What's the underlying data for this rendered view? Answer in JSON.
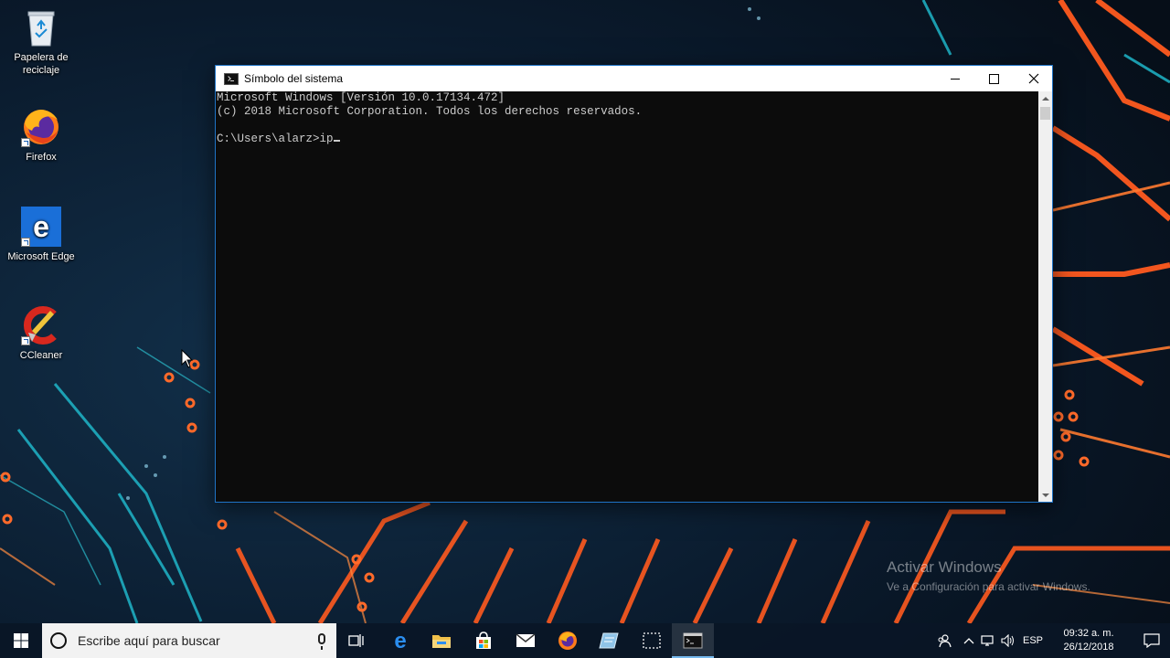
{
  "desktop": {
    "icons": [
      {
        "label": "Papelera de\nreciclaje",
        "icon": "recycle-bin-icon"
      },
      {
        "label": "Firefox",
        "icon": "firefox-icon"
      },
      {
        "label": "Microsoft Edge",
        "icon": "edge-icon"
      },
      {
        "label": "CCleaner",
        "icon": "ccleaner-icon"
      }
    ]
  },
  "window": {
    "title": "Símbolo del sistema",
    "console_lines": [
      "Microsoft Windows [Versión 10.0.17134.472]",
      "(c) 2018 Microsoft Corporation. Todos los derechos reservados.",
      "",
      "C:\\Users\\alarz>ip"
    ]
  },
  "watermark": {
    "title": "Activar Windows",
    "subtitle": "Ve a Configuración para activar Windows."
  },
  "taskbar": {
    "search_placeholder": "Escribe aquí para buscar",
    "apps": [
      "task-view-icon",
      "edge-icon",
      "file-explorer-icon",
      "store-icon",
      "mail-icon",
      "firefox-icon",
      "notes-icon",
      "snipping-tool-icon",
      "command-prompt-icon"
    ],
    "active_app": "command-prompt-icon",
    "language": "ESP",
    "time": "09:32 a. m.",
    "date": "26/12/2018"
  },
  "colors": {
    "console_bg": "#0c0c0c",
    "console_text": "#cccccc",
    "accent": "#1f74c7",
    "wallpaper_orange": "#ff5a1f",
    "wallpaper_cyan": "#1fb5c8"
  }
}
